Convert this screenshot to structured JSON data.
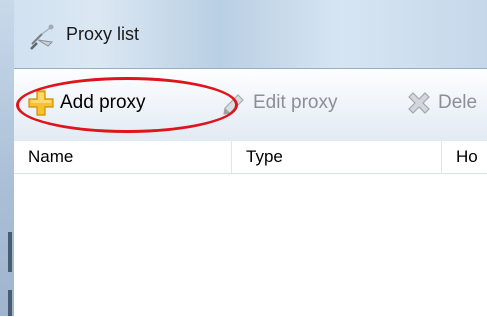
{
  "window": {
    "title": "Proxy list",
    "title_icon": "satellite-dish-icon"
  },
  "toolbar": {
    "add_label": "Add proxy",
    "add_icon": "plus-icon",
    "edit_label": "Edit proxy",
    "edit_icon": "pencil-icon",
    "delete_label": "Dele",
    "delete_icon": "delete-x-icon"
  },
  "list": {
    "columns": [
      "Name",
      "Type",
      "Ho"
    ],
    "rows": []
  },
  "colors": {
    "highlight": "#e0141b",
    "disabled_text": "#8b8f96",
    "add_icon": "#f5b400"
  }
}
